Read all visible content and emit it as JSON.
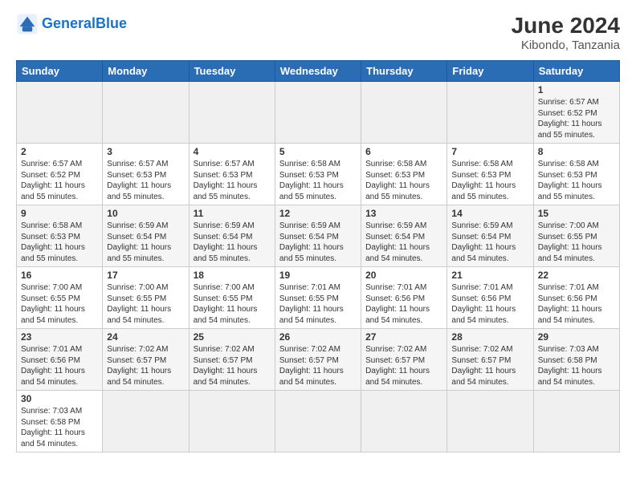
{
  "header": {
    "logo_general": "General",
    "logo_blue": "Blue",
    "month_title": "June 2024",
    "location": "Kibondo, Tanzania"
  },
  "weekdays": [
    "Sunday",
    "Monday",
    "Tuesday",
    "Wednesday",
    "Thursday",
    "Friday",
    "Saturday"
  ],
  "weeks": [
    [
      {
        "day": null,
        "empty": true
      },
      {
        "day": null,
        "empty": true
      },
      {
        "day": null,
        "empty": true
      },
      {
        "day": null,
        "empty": true
      },
      {
        "day": null,
        "empty": true
      },
      {
        "day": null,
        "empty": true
      },
      {
        "day": "1",
        "sunrise": "6:57 AM",
        "sunset": "6:52 PM",
        "daylight": "11 hours and 55 minutes."
      }
    ],
    [
      {
        "day": "2",
        "sunrise": "6:57 AM",
        "sunset": "6:52 PM",
        "daylight": "11 hours and 55 minutes."
      },
      {
        "day": "3",
        "sunrise": "6:57 AM",
        "sunset": "6:53 PM",
        "daylight": "11 hours and 55 minutes."
      },
      {
        "day": "4",
        "sunrise": "6:57 AM",
        "sunset": "6:53 PM",
        "daylight": "11 hours and 55 minutes."
      },
      {
        "day": "5",
        "sunrise": "6:58 AM",
        "sunset": "6:53 PM",
        "daylight": "11 hours and 55 minutes."
      },
      {
        "day": "6",
        "sunrise": "6:58 AM",
        "sunset": "6:53 PM",
        "daylight": "11 hours and 55 minutes."
      },
      {
        "day": "7",
        "sunrise": "6:58 AM",
        "sunset": "6:53 PM",
        "daylight": "11 hours and 55 minutes."
      },
      {
        "day": "8",
        "sunrise": "6:58 AM",
        "sunset": "6:53 PM",
        "daylight": "11 hours and 55 minutes."
      }
    ],
    [
      {
        "day": "9",
        "sunrise": "6:58 AM",
        "sunset": "6:53 PM",
        "daylight": "11 hours and 55 minutes."
      },
      {
        "day": "10",
        "sunrise": "6:59 AM",
        "sunset": "6:54 PM",
        "daylight": "11 hours and 55 minutes."
      },
      {
        "day": "11",
        "sunrise": "6:59 AM",
        "sunset": "6:54 PM",
        "daylight": "11 hours and 55 minutes."
      },
      {
        "day": "12",
        "sunrise": "6:59 AM",
        "sunset": "6:54 PM",
        "daylight": "11 hours and 55 minutes."
      },
      {
        "day": "13",
        "sunrise": "6:59 AM",
        "sunset": "6:54 PM",
        "daylight": "11 hours and 54 minutes."
      },
      {
        "day": "14",
        "sunrise": "6:59 AM",
        "sunset": "6:54 PM",
        "daylight": "11 hours and 54 minutes."
      },
      {
        "day": "15",
        "sunrise": "7:00 AM",
        "sunset": "6:55 PM",
        "daylight": "11 hours and 54 minutes."
      }
    ],
    [
      {
        "day": "16",
        "sunrise": "7:00 AM",
        "sunset": "6:55 PM",
        "daylight": "11 hours and 54 minutes."
      },
      {
        "day": "17",
        "sunrise": "7:00 AM",
        "sunset": "6:55 PM",
        "daylight": "11 hours and 54 minutes."
      },
      {
        "day": "18",
        "sunrise": "7:00 AM",
        "sunset": "6:55 PM",
        "daylight": "11 hours and 54 minutes."
      },
      {
        "day": "19",
        "sunrise": "7:01 AM",
        "sunset": "6:55 PM",
        "daylight": "11 hours and 54 minutes."
      },
      {
        "day": "20",
        "sunrise": "7:01 AM",
        "sunset": "6:56 PM",
        "daylight": "11 hours and 54 minutes."
      },
      {
        "day": "21",
        "sunrise": "7:01 AM",
        "sunset": "6:56 PM",
        "daylight": "11 hours and 54 minutes."
      },
      {
        "day": "22",
        "sunrise": "7:01 AM",
        "sunset": "6:56 PM",
        "daylight": "11 hours and 54 minutes."
      }
    ],
    [
      {
        "day": "23",
        "sunrise": "7:01 AM",
        "sunset": "6:56 PM",
        "daylight": "11 hours and 54 minutes."
      },
      {
        "day": "24",
        "sunrise": "7:02 AM",
        "sunset": "6:57 PM",
        "daylight": "11 hours and 54 minutes."
      },
      {
        "day": "25",
        "sunrise": "7:02 AM",
        "sunset": "6:57 PM",
        "daylight": "11 hours and 54 minutes."
      },
      {
        "day": "26",
        "sunrise": "7:02 AM",
        "sunset": "6:57 PM",
        "daylight": "11 hours and 54 minutes."
      },
      {
        "day": "27",
        "sunrise": "7:02 AM",
        "sunset": "6:57 PM",
        "daylight": "11 hours and 54 minutes."
      },
      {
        "day": "28",
        "sunrise": "7:02 AM",
        "sunset": "6:57 PM",
        "daylight": "11 hours and 54 minutes."
      },
      {
        "day": "29",
        "sunrise": "7:03 AM",
        "sunset": "6:58 PM",
        "daylight": "11 hours and 54 minutes."
      }
    ],
    [
      {
        "day": "30",
        "sunrise": "7:03 AM",
        "sunset": "6:58 PM",
        "daylight": "11 hours and 54 minutes."
      },
      {
        "day": null,
        "empty": true
      },
      {
        "day": null,
        "empty": true
      },
      {
        "day": null,
        "empty": true
      },
      {
        "day": null,
        "empty": true
      },
      {
        "day": null,
        "empty": true
      },
      {
        "day": null,
        "empty": true
      }
    ]
  ],
  "labels": {
    "sunrise": "Sunrise:",
    "sunset": "Sunset:",
    "daylight": "Daylight:"
  }
}
